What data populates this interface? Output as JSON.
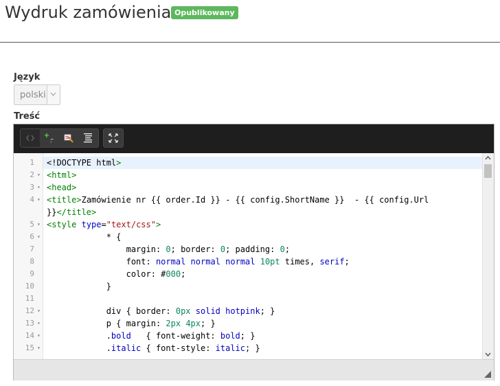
{
  "header": {
    "title": "Wydruk zamówienia",
    "status_badge": "Opublikowany",
    "badge_color": "#5cb85c"
  },
  "language": {
    "label": "Język",
    "selected": "polski"
  },
  "content": {
    "label": "Treść"
  },
  "toolbar": {
    "icons": [
      "code-view-icon",
      "insert-variable-icon",
      "highlight-icon",
      "format-icon",
      "fullscreen-icon"
    ]
  },
  "editor": {
    "lines": [
      {
        "n": "1",
        "fold": "",
        "text": "<!DOCTYPE html>"
      },
      {
        "n": "2",
        "fold": "▾",
        "text": "<html>"
      },
      {
        "n": "3",
        "fold": "▾",
        "text": "<head>"
      },
      {
        "n": "4",
        "fold": "▾",
        "text": "<title>Zamówienie nr {{ order.Id }} - {{ config.ShortName }}  - {{ config.Url"
      },
      {
        "n": "",
        "fold": "",
        "text": "}}</title>"
      },
      {
        "n": "5",
        "fold": "▾",
        "text": "<style type=\"text/css\">"
      },
      {
        "n": "6",
        "fold": "▾",
        "text": "            * {"
      },
      {
        "n": "7",
        "fold": "",
        "text": "                margin: 0; border: 0; padding: 0;"
      },
      {
        "n": "8",
        "fold": "",
        "text": "                font: normal normal normal 10pt times, serif;"
      },
      {
        "n": "9",
        "fold": "",
        "text": "                color: #000;"
      },
      {
        "n": "10",
        "fold": "",
        "text": "            }"
      },
      {
        "n": "11",
        "fold": "",
        "text": ""
      },
      {
        "n": "12",
        "fold": "▾",
        "text": "            div { border: 0px solid hotpink; }"
      },
      {
        "n": "13",
        "fold": "▾",
        "text": "            p { margin: 2px 4px; }"
      },
      {
        "n": "14",
        "fold": "▾",
        "text": "            .bold   { font-weight: bold; }"
      },
      {
        "n": "15",
        "fold": "▾",
        "text": "            .italic { font-style: italic; }"
      }
    ]
  }
}
